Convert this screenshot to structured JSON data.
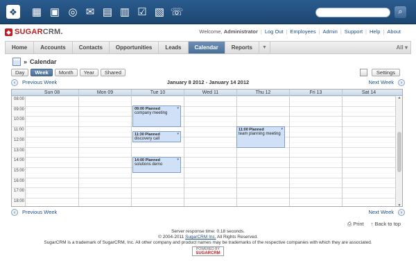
{
  "topbar": {
    "icons": [
      "sugar-cube-icon",
      "accounts-icon",
      "contacts-icon",
      "opportunities-icon",
      "email-icon",
      "documents-icon",
      "reports-icon",
      "projects-icon",
      "calendar-icon",
      "phone-icon"
    ],
    "search_placeholder": ""
  },
  "header": {
    "logo_text_a": "SUGAR",
    "logo_text_b": "CRM.",
    "welcome": "Welcome,",
    "user": "Administrator",
    "links": [
      "Log Out",
      "Employees",
      "Admin",
      "Support",
      "Help",
      "About"
    ]
  },
  "tabs": [
    "Home",
    "Accounts",
    "Contacts",
    "Opportunities",
    "Leads",
    "Calendar",
    "Reports"
  ],
  "active_tab": "Calendar",
  "all_menu": "All",
  "module": {
    "separator": "»",
    "title": "Calendar"
  },
  "views": [
    "Day",
    "Week",
    "Month",
    "Year",
    "Shared"
  ],
  "active_view": "Week",
  "settings_label": "Settings",
  "nav": {
    "prev": "Previous Week",
    "next": "Next Week",
    "range": "January 8 2012 - January 14 2012"
  },
  "days": [
    "Sun 08",
    "Mon 09",
    "Tue 10",
    "Wed 11",
    "Thu 12",
    "Fri 13",
    "Sat 14"
  ],
  "times": [
    "08:00",
    "09:00",
    "10:00",
    "11:00",
    "12:00",
    "13:00",
    "14:00",
    "15:00",
    "16:00",
    "17:00",
    "18:00"
  ],
  "events": [
    {
      "day": 2,
      "time": "09:00 Planned",
      "title": "company meeting"
    },
    {
      "day": 2,
      "time": "11:30 Planned",
      "title": "discovery call"
    },
    {
      "day": 2,
      "time": "14:00 Planned",
      "title": "solutions demo"
    },
    {
      "day": 4,
      "time": "11:00 Planned",
      "title": "team planning meeting"
    }
  ],
  "footer": {
    "print": "Print",
    "back_to_top": "Back to top",
    "response": "Server response time: 0.18 seconds.",
    "copyright_prefix": "© 2004-2011 ",
    "copyright_link": "SugarCRM Inc.",
    "copyright_suffix": " All Rights Reserved.",
    "trademark": "SugarCRM is a trademark of SugarCRM, Inc. All other company and product names may be trademarks of the respective companies with which they are associated.",
    "powered_by": "POWERED BY",
    "powered_brand": "SUGARCRM"
  },
  "colors": {
    "accent": "#4a6f97",
    "brand_red": "#c21d22",
    "event_fill": "#cfe0f7"
  }
}
